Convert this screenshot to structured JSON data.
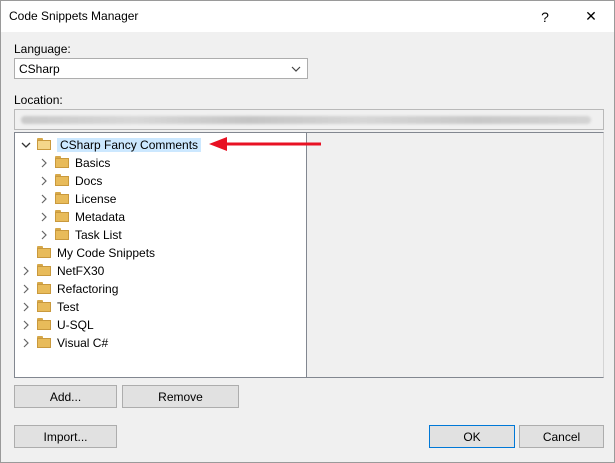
{
  "window": {
    "title": "Code Snippets Manager",
    "help_label": "?",
    "close_label": "✕"
  },
  "language": {
    "label": "Language:",
    "selected": "CSharp"
  },
  "location": {
    "label": "Location:"
  },
  "tree": {
    "selected_node": "CSharp Fancy Comments",
    "children": [
      "Basics",
      "Docs",
      "License",
      "Metadata",
      "Task List"
    ],
    "top_nodes": [
      "My Code Snippets",
      "NetFX30",
      "Refactoring",
      "Test",
      "U-SQL",
      "Visual C#"
    ]
  },
  "buttons": {
    "add": "Add...",
    "remove": "Remove",
    "import": "Import...",
    "ok": "OK",
    "cancel": "Cancel"
  },
  "colors": {
    "selection": "#cce8ff",
    "annotation_arrow": "#e81123",
    "default_button_border": "#0078d7"
  }
}
